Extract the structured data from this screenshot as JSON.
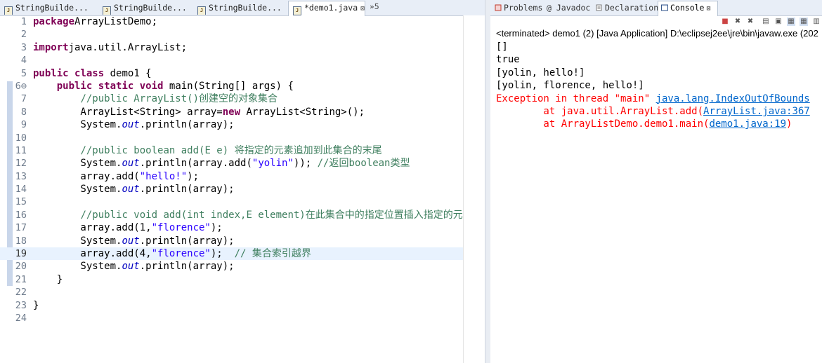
{
  "editor": {
    "tabs": [
      {
        "label": "StringBuilde..."
      },
      {
        "label": "StringBuilde..."
      },
      {
        "label": "StringBuilde..."
      },
      {
        "label": "*demo1.java",
        "close": "⊠"
      }
    ],
    "overflow": "»5",
    "lines": [
      {
        "n": "1",
        "parts": [
          [
            "kw",
            "package"
          ],
          [
            "",
            "ArrayListDemo;"
          ]
        ]
      },
      {
        "n": "2",
        "parts": []
      },
      {
        "n": "3",
        "parts": [
          [
            "kw",
            "import"
          ],
          [
            "",
            "java.util.ArrayList;"
          ]
        ]
      },
      {
        "n": "4",
        "parts": []
      },
      {
        "n": "5",
        "parts": [
          [
            "kw",
            "public"
          ],
          [
            "",
            " "
          ],
          [
            "kw",
            "class"
          ],
          [
            "",
            " demo1 {"
          ]
        ]
      },
      {
        "n": "6⊖",
        "parts": [
          [
            "",
            "    "
          ],
          [
            "kw",
            "public"
          ],
          [
            "",
            " "
          ],
          [
            "kw",
            "static"
          ],
          [
            "",
            " "
          ],
          [
            "kw",
            "void"
          ],
          [
            "",
            " main(String[] args) {"
          ]
        ]
      },
      {
        "n": "7",
        "parts": [
          [
            "",
            "        "
          ],
          [
            "cm",
            "//public ArrayList()创建空的对象集合"
          ]
        ]
      },
      {
        "n": "8",
        "parts": [
          [
            "",
            "        ArrayList<String> array="
          ],
          [
            "kw",
            "new"
          ],
          [
            "",
            " ArrayList<String>();"
          ]
        ]
      },
      {
        "n": "9",
        "parts": [
          [
            "",
            "        System."
          ],
          [
            "fld",
            "out"
          ],
          [
            "",
            ".println(array);"
          ]
        ]
      },
      {
        "n": "10",
        "parts": []
      },
      {
        "n": "11",
        "parts": [
          [
            "",
            "        "
          ],
          [
            "cm",
            "//public boolean add(E e) 将指定的元素追加到此集合的末尾"
          ]
        ]
      },
      {
        "n": "12",
        "parts": [
          [
            "",
            "        System."
          ],
          [
            "fld",
            "out"
          ],
          [
            "",
            ".println(array.add("
          ],
          [
            "str",
            "\"yolin\""
          ],
          [
            "",
            "));"
          ],
          [
            "cm",
            " //返回boolean类型"
          ]
        ]
      },
      {
        "n": "13",
        "parts": [
          [
            "",
            "        array.add("
          ],
          [
            "str",
            "\"hello!\""
          ],
          [
            "",
            ");"
          ]
        ]
      },
      {
        "n": "14",
        "parts": [
          [
            "",
            "        System."
          ],
          [
            "fld",
            "out"
          ],
          [
            "",
            ".println(array);"
          ]
        ]
      },
      {
        "n": "15",
        "parts": []
      },
      {
        "n": "16",
        "parts": [
          [
            "",
            "        "
          ],
          [
            "cm",
            "//public void add(int index,E element)在此集合中的指定位置插入指定的元素"
          ]
        ]
      },
      {
        "n": "17",
        "parts": [
          [
            "",
            "        array.add(1,"
          ],
          [
            "str",
            "\"florence\""
          ],
          [
            "",
            ");"
          ]
        ]
      },
      {
        "n": "18",
        "parts": [
          [
            "",
            "        System."
          ],
          [
            "fld",
            "out"
          ],
          [
            "",
            ".println(array);"
          ]
        ]
      },
      {
        "n": "19",
        "parts": [
          [
            "",
            "        array.add(4,"
          ],
          [
            "str",
            "\"florence\""
          ],
          [
            "",
            ");  "
          ],
          [
            "cm",
            "// 集合索引越界"
          ]
        ],
        "current": true
      },
      {
        "n": "20",
        "parts": [
          [
            "",
            "        System."
          ],
          [
            "fld",
            "out"
          ],
          [
            "",
            ".println(array);"
          ]
        ]
      },
      {
        "n": "21",
        "parts": [
          [
            "",
            "    }"
          ]
        ]
      },
      {
        "n": "22",
        "parts": []
      },
      {
        "n": "23",
        "parts": [
          [
            "",
            "}"
          ]
        ]
      },
      {
        "n": "24",
        "parts": []
      }
    ]
  },
  "views": {
    "tabs": [
      {
        "label": "Problems",
        "icon": "problems-icon"
      },
      {
        "label": "@ Javadoc",
        "icon": "javadoc-icon"
      },
      {
        "label": "Declaration",
        "icon": "declaration-icon"
      },
      {
        "label": "Console",
        "icon": "console-icon",
        "close": "⊠"
      }
    ]
  },
  "console": {
    "status": "<terminated> demo1 (2) [Java Application] D:\\eclipsej2ee\\jre\\bin\\javaw.exe (202",
    "output": [
      {
        "parts": [
          [
            "",
            "[]"
          ]
        ]
      },
      {
        "parts": [
          [
            "",
            "true"
          ]
        ]
      },
      {
        "parts": [
          [
            "",
            "[yolin, hello!]"
          ]
        ]
      },
      {
        "parts": [
          [
            "",
            "[yolin, florence, hello!]"
          ]
        ]
      },
      {
        "parts": [
          [
            "err",
            "Exception in thread \"main\" "
          ],
          [
            "lnk",
            "java.lang.IndexOutOfBounds"
          ]
        ]
      },
      {
        "parts": [
          [
            "err",
            "        at java.util.ArrayList.add("
          ],
          [
            "lnk",
            "ArrayList.java:367"
          ]
        ]
      },
      {
        "parts": [
          [
            "err",
            "        at ArrayListDemo.demo1.main("
          ],
          [
            "lnk",
            "demo1.java:19"
          ],
          [
            "err",
            ")"
          ]
        ]
      }
    ]
  },
  "colors": {
    "keyword": "#7f0055",
    "comment": "#3f7f5f",
    "string": "#2a00ff",
    "field": "#0000c0",
    "error": "#ff0000",
    "link": "#0066cc"
  }
}
